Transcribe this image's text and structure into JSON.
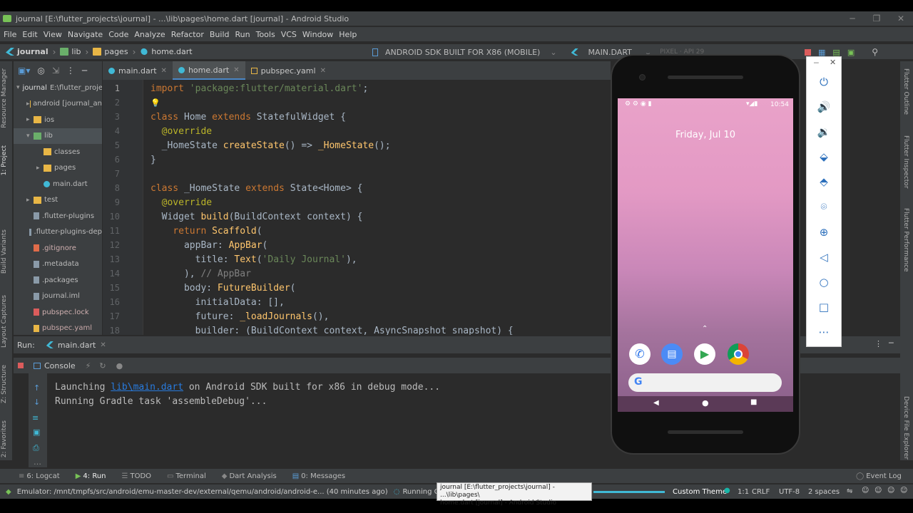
{
  "window": {
    "title": "journal [E:\\flutter_projects\\journal] - ...\\lib\\pages\\home.dart [journal] - Android Studio"
  },
  "menu": [
    "File",
    "Edit",
    "View",
    "Navigate",
    "Code",
    "Analyze",
    "Refactor",
    "Build",
    "Run",
    "Tools",
    "VCS",
    "Window",
    "Help"
  ],
  "breadcrumbs": [
    "journal",
    "lib",
    "pages",
    "home.dart"
  ],
  "device_selector": "ANDROID SDK BUILT FOR X86 (MOBILE)",
  "config_selector": "MAIN.DART",
  "pixel_selector": "PIXEL · API 29",
  "left_strip": [
    "Resource Manager",
    "1: Project",
    "Build Variants",
    "Layout Captures",
    "Z: Structure",
    "2: Favorites"
  ],
  "right_strip": [
    "Flutter Outline",
    "Flutter Inspector",
    "Flutter Performance",
    "Device File Explorer"
  ],
  "project": {
    "root_name": "journal",
    "root_path": "E:\\flutter_proje",
    "items": [
      {
        "label": "android [journal_an",
        "indent": 1,
        "type": "folder",
        "arrow": "▸"
      },
      {
        "label": "ios",
        "indent": 1,
        "type": "folder",
        "arrow": "▸"
      },
      {
        "label": "lib",
        "indent": 1,
        "type": "folder",
        "arrow": "▾",
        "selected": true
      },
      {
        "label": "classes",
        "indent": 2,
        "type": "folder",
        "arrow": ""
      },
      {
        "label": "pages",
        "indent": 2,
        "type": "folder",
        "arrow": "▸"
      },
      {
        "label": "main.dart",
        "indent": 2,
        "type": "dart",
        "arrow": ""
      },
      {
        "label": "test",
        "indent": 1,
        "type": "folder",
        "arrow": "▸"
      },
      {
        "label": ".flutter-plugins",
        "indent": 1,
        "type": "file",
        "arrow": ""
      },
      {
        "label": ".flutter-plugins-dep",
        "indent": 1,
        "type": "file",
        "arrow": ""
      },
      {
        "label": ".gitignore",
        "indent": 1,
        "type": "git",
        "arrow": ""
      },
      {
        "label": ".metadata",
        "indent": 1,
        "type": "file",
        "arrow": ""
      },
      {
        "label": ".packages",
        "indent": 1,
        "type": "file",
        "arrow": ""
      },
      {
        "label": "journal.iml",
        "indent": 1,
        "type": "file",
        "arrow": ""
      },
      {
        "label": "pubspec.lock",
        "indent": 1,
        "type": "lock",
        "arrow": ""
      },
      {
        "label": "pubspec.yaml",
        "indent": 1,
        "type": "yaml",
        "arrow": ""
      }
    ]
  },
  "editor_tabs": [
    {
      "label": "main.dart",
      "active": false
    },
    {
      "label": "home.dart",
      "active": true
    },
    {
      "label": "pubspec.yaml",
      "active": false
    }
  ],
  "line_numbers": [
    "1",
    "2",
    "3",
    "4",
    "5",
    "6",
    "7",
    "8",
    "9",
    "10",
    "11",
    "12",
    "13",
    "14",
    "15",
    "16",
    "17",
    "18"
  ],
  "run": {
    "label": "Run:",
    "tab": "main.dart",
    "console_tab": "Console"
  },
  "console_lines": [
    {
      "pre": "Launching ",
      "link": "lib\\main.dart",
      "post": " on Android SDK built for x86 in debug mode..."
    },
    {
      "pre": "Running Gradle task 'assembleDebug'...",
      "link": "",
      "post": ""
    }
  ],
  "tool_windows": [
    "6: Logcat",
    "4: Run",
    "TODO",
    "Terminal",
    "Dart Analysis",
    "0: Messages",
    "Event Log"
  ],
  "status": {
    "emulator": "Emulator: /mnt/tmpfs/src/android/emu-master-dev/external/qemu/android/android-e... (40 minutes ago)",
    "task": "Running Gradle task 'assem",
    "theme": "Custom Theme",
    "position": "1:1",
    "line_sep": "CRLF",
    "encoding": "UTF-8",
    "indent": "2 spaces"
  },
  "tooltip": {
    "line1": "journal [E:\\flutter_projects\\journal] - ...\\lib\\pages\\",
    "line2": "home.dart [journal] - Android Studio"
  },
  "phone": {
    "time": "10:54",
    "date": "Friday, Jul 10"
  }
}
